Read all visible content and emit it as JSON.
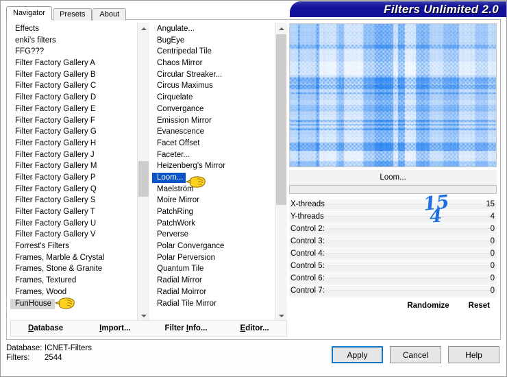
{
  "window": {
    "title": "Filters Unlimited 2.0"
  },
  "tabs": [
    {
      "label": "Navigator",
      "active": true
    },
    {
      "label": "Presets",
      "active": false
    },
    {
      "label": "About",
      "active": false
    }
  ],
  "categories": {
    "items": [
      {
        "label": "Effects",
        "state": "normal"
      },
      {
        "label": "enki's filters",
        "state": "normal"
      },
      {
        "label": "FFG???",
        "state": "normal"
      },
      {
        "label": "Filter Factory Gallery A",
        "state": "normal"
      },
      {
        "label": "Filter Factory Gallery B",
        "state": "normal"
      },
      {
        "label": "Filter Factory Gallery C",
        "state": "normal"
      },
      {
        "label": "Filter Factory Gallery D",
        "state": "normal"
      },
      {
        "label": "Filter Factory Gallery E",
        "state": "normal"
      },
      {
        "label": "Filter Factory Gallery F",
        "state": "normal"
      },
      {
        "label": "Filter Factory Gallery G",
        "state": "normal"
      },
      {
        "label": "Filter Factory Gallery H",
        "state": "normal"
      },
      {
        "label": "Filter Factory Gallery J",
        "state": "normal"
      },
      {
        "label": "Filter Factory Gallery M",
        "state": "normal"
      },
      {
        "label": "Filter Factory Gallery P",
        "state": "normal"
      },
      {
        "label": "Filter Factory Gallery Q",
        "state": "normal"
      },
      {
        "label": "Filter Factory Gallery S",
        "state": "normal"
      },
      {
        "label": "Filter Factory Gallery T",
        "state": "normal"
      },
      {
        "label": "Filter Factory Gallery U",
        "state": "normal"
      },
      {
        "label": "Filter Factory Gallery V",
        "state": "normal"
      },
      {
        "label": "Forrest's Filters",
        "state": "normal"
      },
      {
        "label": "Frames, Marble & Crystal",
        "state": "normal"
      },
      {
        "label": "Frames, Stone & Granite",
        "state": "normal"
      },
      {
        "label": "Frames, Textured",
        "state": "normal"
      },
      {
        "label": "Frames, Wood",
        "state": "normal"
      },
      {
        "label": "FunHouse",
        "state": "selected-inactive"
      }
    ],
    "scroll_thumb_top_pct": 46,
    "scroll_thumb_height_pct": 13
  },
  "filters": {
    "items": [
      {
        "label": "Angulate...",
        "state": "normal"
      },
      {
        "label": "BugEye",
        "state": "normal"
      },
      {
        "label": "Centripedal Tile",
        "state": "normal"
      },
      {
        "label": "Chaos Mirror",
        "state": "normal"
      },
      {
        "label": "Circular Streaker...",
        "state": "normal"
      },
      {
        "label": "Circus Maximus",
        "state": "normal"
      },
      {
        "label": "Cirquelate",
        "state": "normal"
      },
      {
        "label": "Convergance",
        "state": "normal"
      },
      {
        "label": "Emission Mirror",
        "state": "normal"
      },
      {
        "label": "Evanescence",
        "state": "normal"
      },
      {
        "label": "Facet Offset",
        "state": "normal"
      },
      {
        "label": "Faceter...",
        "state": "normal"
      },
      {
        "label": "Heizenberg's Mirror",
        "state": "normal"
      },
      {
        "label": "Loom...",
        "state": "selected"
      },
      {
        "label": "Maelström",
        "state": "normal"
      },
      {
        "label": "Moire Mirror",
        "state": "normal"
      },
      {
        "label": "PatchRing",
        "state": "normal"
      },
      {
        "label": "PatchWork",
        "state": "normal"
      },
      {
        "label": "Perverse",
        "state": "normal"
      },
      {
        "label": "Polar Convergance",
        "state": "normal"
      },
      {
        "label": "Polar Perversion",
        "state": "normal"
      },
      {
        "label": "Quantum Tile",
        "state": "normal"
      },
      {
        "label": "Radial Mirror",
        "state": "normal"
      },
      {
        "label": "Radial Moirror",
        "state": "normal"
      },
      {
        "label": "Radial Tile Mirror",
        "state": "normal"
      }
    ],
    "scroll_thumb_top_pct": 0,
    "scroll_thumb_height_pct": 62
  },
  "right_panel": {
    "filter_title": "Loom...",
    "preset_value": "",
    "controls": [
      {
        "label": "X-threads",
        "value": "15"
      },
      {
        "label": "Y-threads",
        "value": "4"
      },
      {
        "label": "Control 2:",
        "value": "0"
      },
      {
        "label": "Control 3:",
        "value": "0"
      },
      {
        "label": "Control 4:",
        "value": "0"
      },
      {
        "label": "Control 5:",
        "value": "0"
      },
      {
        "label": "Control 6:",
        "value": "0"
      },
      {
        "label": "Control 7:",
        "value": "0"
      }
    ],
    "randomize_label": "Randomize",
    "reset_label": "Reset"
  },
  "menubar": {
    "items": [
      {
        "mnemonic": "D",
        "rest": "atabase"
      },
      {
        "mnemonic": "I",
        "pre": "",
        "rest": "mport..."
      },
      {
        "pre": "Filter ",
        "mnemonic": "I",
        "rest": "nfo..."
      },
      {
        "mnemonic": "E",
        "rest": "ditor..."
      }
    ]
  },
  "status": {
    "database_label": "Database:",
    "database_value": "ICNET-Filters",
    "filters_label": "Filters:",
    "filters_value": "2544"
  },
  "buttons": {
    "apply": "Apply",
    "cancel": "Cancel",
    "help": "Help"
  },
  "annotations": {
    "x_threads_note": "15",
    "y_threads_note": "4"
  },
  "colors": {
    "banner_blue": "#12129c",
    "selection_blue": "#0a54c8",
    "annotation_blue": "#1f6fe0",
    "focus_blue": "#1577c4",
    "preview_blue": "#1e7ff0"
  }
}
